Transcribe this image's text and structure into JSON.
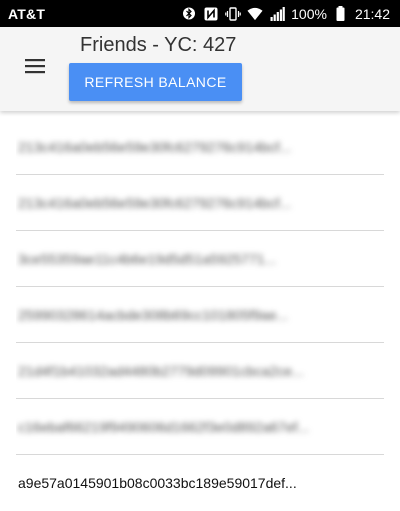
{
  "status_bar": {
    "carrier": "AT&T",
    "battery": "100%",
    "time": "21:42",
    "icons": [
      "bluetooth-icon",
      "nfc-icon",
      "vibrate-icon",
      "wifi-icon",
      "signal-icon",
      "battery-icon"
    ]
  },
  "app_bar": {
    "title": "Friends - YC: 427",
    "refresh_label": "REFRESH BALANCE",
    "menu_icon": "hamburger-menu-icon"
  },
  "friends": [
    {
      "id": "213c416a0eb56e59e30fc6279276c914bcf...",
      "blurred": true
    },
    {
      "id": "213c416a0eb56e59e30fc6279276c914bcf...",
      "blurred": true
    },
    {
      "id": "3ce55359ae11c4b6e19d5d51a5925771...",
      "blurred": true
    },
    {
      "id": "25990328614acbde308b69cc101805f9ae...",
      "blurred": true
    },
    {
      "id": "21d4f1b41032ad4480b2779d09901cbca2ce...",
      "blurred": true
    },
    {
      "id": "c16ebaf66219f9490606d1662f3e0d892a67ef...",
      "blurred": true
    },
    {
      "id": "a9e57a0145901b08c0033bc189e59017def...",
      "blurred": false
    }
  ],
  "colors": {
    "accent": "#4a8ff4",
    "app_bar_bg": "#f5f5f5",
    "status_bar_bg": "#000000"
  }
}
